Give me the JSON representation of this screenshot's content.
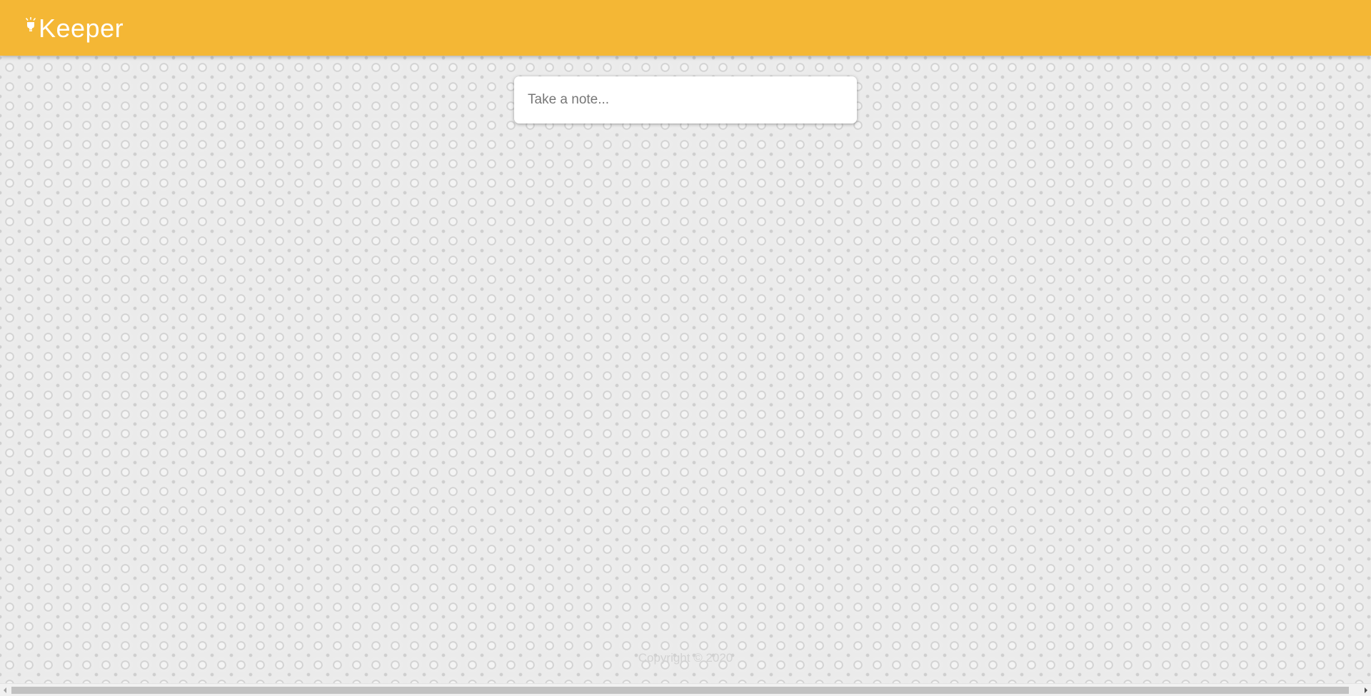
{
  "header": {
    "app_name": "Keeper",
    "background_color": "#f4b735",
    "logo_icon": "lightbulb-icon"
  },
  "note_form": {
    "placeholder": "Take a note..."
  },
  "footer": {
    "copyright": "Copyright © 2020"
  },
  "scrollbar": {
    "left_icon": "scroll-left-arrow-icon",
    "right_icon": "scroll-right-arrow-icon"
  }
}
